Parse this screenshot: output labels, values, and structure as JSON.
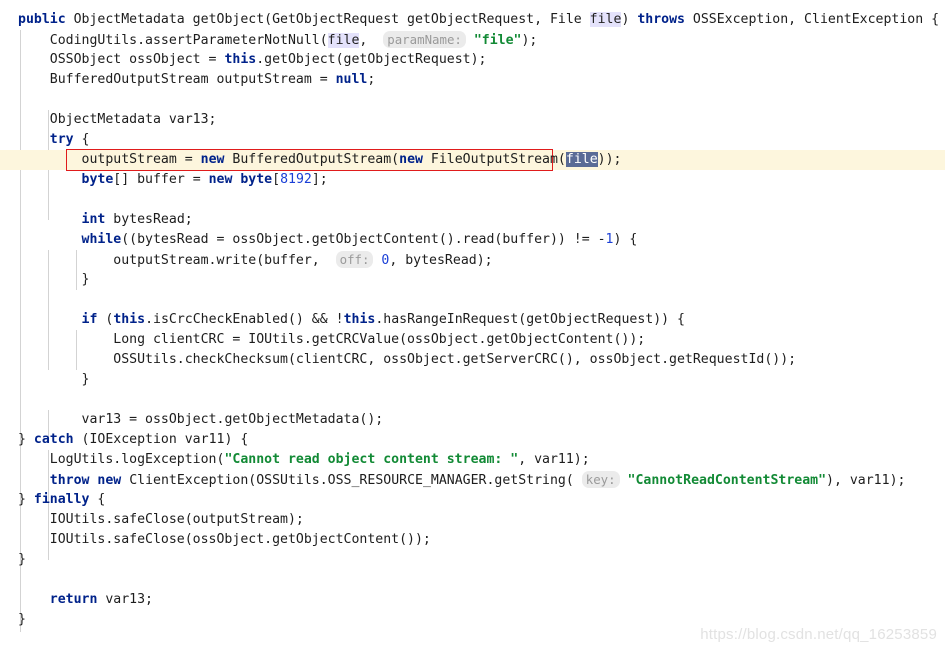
{
  "editor": {
    "language": "java",
    "colors": {
      "background": "#ffffff",
      "keyword": "#00228a",
      "string": "#128a35",
      "number": "#1a3fd6",
      "plain": "#1d1d1d",
      "caret_row": "#fdf6dd",
      "search_match_border": "#e01b1b",
      "selection": "#5a6b96",
      "usage_highlight": "#e4e2fb",
      "hint_background": "#ebebeb",
      "hint_text": "#9a9a9a",
      "indent_guide": "#d3d3d3",
      "watermark": "#e2e2e2"
    },
    "hints": {
      "param_name": "paramName:",
      "off": "off:",
      "key": "key:"
    },
    "selected_token": "file",
    "usage_token": "file",
    "lines": [
      "public ObjectMetadata getObject(GetObjectRequest getObjectRequest, File file) throws OSSException, ClientException {",
      "    CodingUtils.assertParameterNotNull(file,  paramName: \"file\");",
      "    OSSObject ossObject = this.getObject(getObjectRequest);",
      "    BufferedOutputStream outputStream = null;",
      "",
      "    ObjectMetadata var13;",
      "    try {",
      "        outputStream = new BufferedOutputStream(new FileOutputStream(file));",
      "        byte[] buffer = new byte[8192];",
      "",
      "        int bytesRead;",
      "        while((bytesRead = ossObject.getObjectContent().read(buffer)) != -1) {",
      "            outputStream.write(buffer,  off: 0, bytesRead);",
      "        }",
      "",
      "        if (this.isCrcCheckEnabled() && !this.hasRangeInRequest(getObjectRequest)) {",
      "            Long clientCRC = IOUtils.getCRCValue(ossObject.getObjectContent());",
      "            OSSUtils.checkChecksum(clientCRC, ossObject.getServerCRC(), ossObject.getRequestId());",
      "        }",
      "",
      "        var13 = ossObject.getObjectMetadata();",
      "    } catch (IOException var11) {",
      "        LogUtils.logException(\"Cannot read object content stream: \", var11);",
      "        throw new ClientException(OSSUtils.OSS_RESOURCE_MANAGER.getString( key: \"CannotReadContentStream\"), var11);",
      "    } finally {",
      "        IOUtils.safeClose(outputStream);",
      "        IOUtils.safeClose(ossObject.getObjectContent());",
      "    }",
      "",
      "    return var13;",
      "}"
    ]
  },
  "watermark": {
    "text": "https://blog.csdn.net/qq_16253859"
  }
}
